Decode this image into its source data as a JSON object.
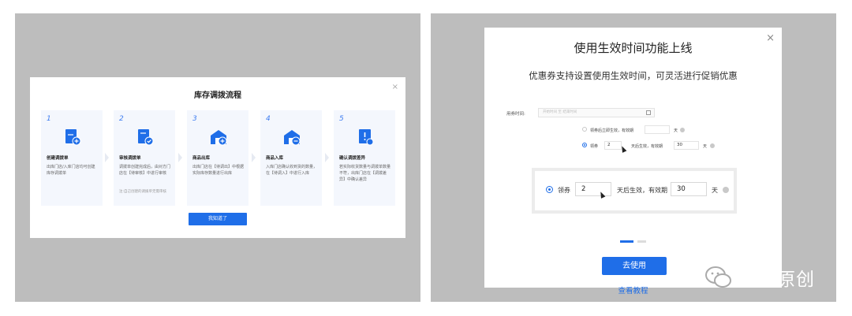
{
  "left_modal": {
    "title": "库存调拨流程",
    "close": "×",
    "steps": [
      {
        "num": "1",
        "name": "创建调拨单",
        "desc": "出库门店/入库门店均可创建库存调拨单",
        "note": "",
        "icon": "document-plus-icon"
      },
      {
        "num": "2",
        "name": "审核调拨单",
        "desc": "调拨单创建完成后，由对方门店在【待审核】中进行审核",
        "note": "注:自己创建的调拨单无需审核",
        "icon": "document-check-icon"
      },
      {
        "num": "3",
        "name": "商品出库",
        "desc": "出库门店在【待调出】中根据实际库存数量进行出库",
        "note": "",
        "icon": "warehouse-out-icon"
      },
      {
        "num": "4",
        "name": "商品入库",
        "desc": "入库门店确认收到货的数量，在【待调入】中进行入库",
        "note": "",
        "icon": "warehouse-in-icon"
      },
      {
        "num": "5",
        "name": "确认调拨差异",
        "desc": "若实际收货数量与调拨单数量不符，出库门店在【调拨差异】中确认差异",
        "note": "",
        "icon": "document-alert-icon"
      }
    ],
    "confirm_button": "我知道了"
  },
  "right_modal": {
    "title": "使用生效时间功能上线",
    "close": "×",
    "subtitle": "优惠券支持设置使用生效时间，可灵活进行促销优惠",
    "form": {
      "time_label": "用券时间:",
      "date_placeholder": "开始时间  至  结束时间",
      "option1_text": "领券后立即生效，有效期",
      "option1_unit": "天",
      "option2_prefix": "领券",
      "option2_days": "2",
      "option2_mid": "天后生效，有效期",
      "option2_valid": "30",
      "option2_unit": "天"
    },
    "callout": {
      "prefix": "领券",
      "days": "2",
      "mid": "天后生效，有效期",
      "valid": "30",
      "unit": "天"
    },
    "pager": {
      "pages": 2,
      "current": 1
    },
    "use_button": "去使用",
    "tutorial_link": "查看教程"
  },
  "watermark": {
    "text": "佳佳原创",
    "icon": "wechat-icon"
  },
  "colors": {
    "primary": "#1f6ee8",
    "backdrop": "#bdbdbd",
    "card_bg": "#f4f7fd"
  }
}
